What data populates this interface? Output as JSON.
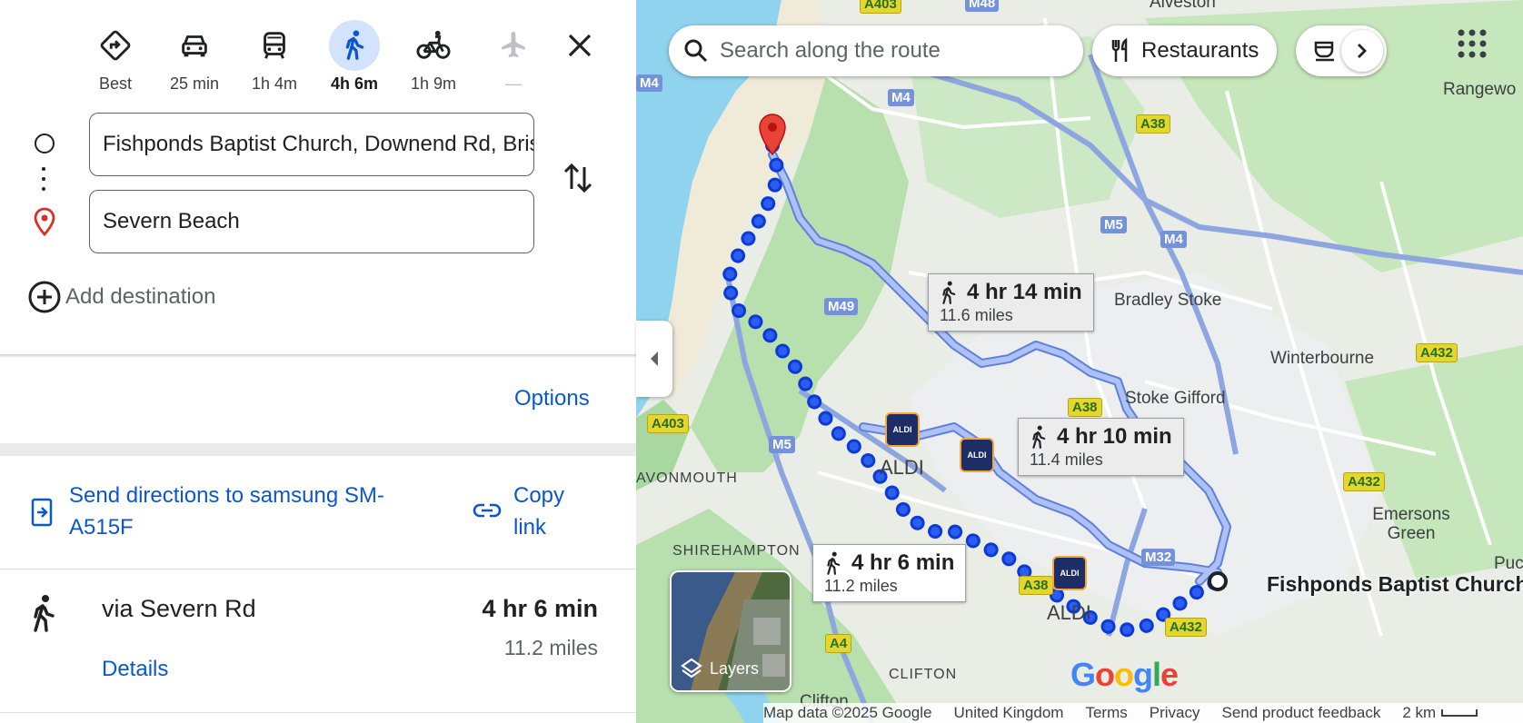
{
  "modes": [
    {
      "label": "Best",
      "icon": "diamond-directions-icon"
    },
    {
      "label": "25 min",
      "icon": "car-icon"
    },
    {
      "label": "1h 4m",
      "icon": "bus-icon"
    },
    {
      "label": "4h 6m",
      "icon": "walk-icon",
      "active": true
    },
    {
      "label": "1h 9m",
      "icon": "bicycle-icon"
    },
    {
      "label": "—",
      "icon": "airplane-icon",
      "disabled": true
    }
  ],
  "origin": "Fishponds Baptist Church, Downend Rd, Bristol",
  "destination": "Severn Beach",
  "add_destination": "Add destination",
  "options": "Options",
  "send_directions": "Send directions to samsung SM-A515F",
  "copy_link": "Copy link",
  "route": {
    "name": "via Severn Rd",
    "time": "4 hr 6 min",
    "distance": "11.2 miles",
    "details": "Details"
  },
  "map": {
    "search_placeholder": "Search along the route",
    "chips": [
      "Restaurants"
    ],
    "labels": [
      {
        "time": "4 hr 14 min",
        "distance": "11.6 miles"
      },
      {
        "time": "4 hr 10 min",
        "distance": "11.4 miles"
      },
      {
        "time": "4 hr 6 min",
        "distance": "11.2 miles"
      }
    ],
    "places": [
      "Alveston",
      "Rangewo",
      "Bradley Stoke",
      "Winterbourne",
      "Stoke Gifford",
      "Emersons Green",
      "Puc",
      "AVONMOUTH",
      "SHIREHAMPTON",
      "CLIFTON",
      "Clifton",
      "ALDI",
      "ALDI",
      "Fishponds Baptist Church"
    ],
    "roads": [
      "A403",
      "M48",
      "M4",
      "M4",
      "A38",
      "M5",
      "M4",
      "M49",
      "A432",
      "A38",
      "A403",
      "M5",
      "A432",
      "M32",
      "A38",
      "A432",
      "A4"
    ],
    "layers": "Layers",
    "google": "Google",
    "footer": [
      "Map data ©2025 Google",
      "United Kingdom",
      "Terms",
      "Privacy",
      "Send product feedback",
      "2 km"
    ]
  }
}
